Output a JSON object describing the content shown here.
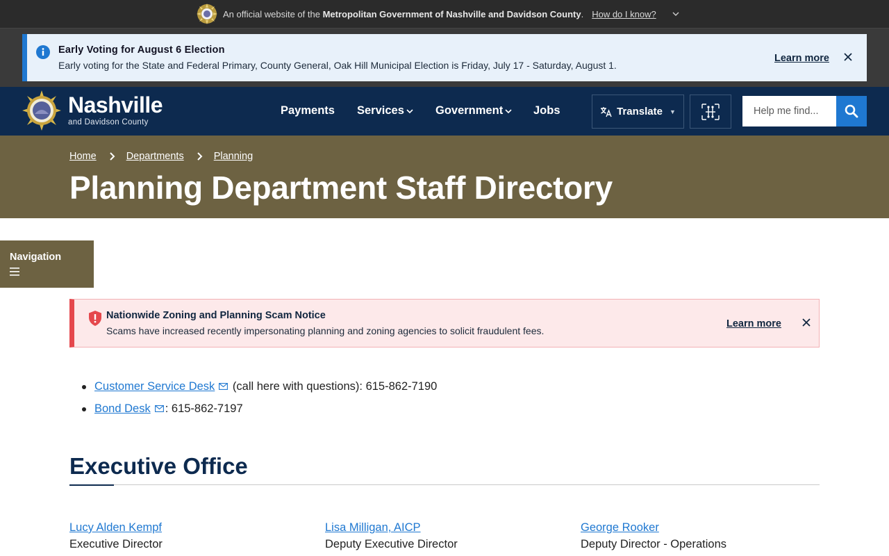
{
  "official_banner": {
    "prefix": "An official website of the",
    "org": "Metropolitan Government of Nashville and Davidson County",
    "suffix": ".",
    "how_link": "How do I know?",
    "icons": {
      "seal": "metro-seal-icon",
      "toggle": "chevron-down-icon"
    }
  },
  "alert": {
    "title": "Early Voting for August 6 Election",
    "body": "Early voting for the State and Federal Primary, County General, Oak Hill Municipal Election is Friday, July 17 - Saturday, August 1.",
    "learn_more": "Learn more",
    "icons": {
      "info": "info-icon",
      "close": "close-icon"
    },
    "accent_color": "#1f78d1"
  },
  "header": {
    "logo_title": "Nashville",
    "logo_subtitle": "and Davidson County",
    "nav": [
      {
        "label": "Payments",
        "has_dropdown": false
      },
      {
        "label": "Services",
        "has_dropdown": true
      },
      {
        "label": "Government",
        "has_dropdown": true
      },
      {
        "label": "Jobs",
        "has_dropdown": false
      }
    ],
    "translate_label": "Translate",
    "search_placeholder": "Help me find...",
    "icons": {
      "translate": "translate-icon",
      "accessibility": "accessibility-tools-icon",
      "search": "search-icon"
    },
    "background_color": "#0d2a4f"
  },
  "hero": {
    "breadcrumb": [
      "Home",
      "Departments",
      "Planning"
    ],
    "title": "Planning Department Staff Directory",
    "background_color": "#6d6242"
  },
  "side_nav": {
    "label": "Navigation",
    "icon": "menu-icon"
  },
  "scam_notice": {
    "title": "Nationwide Zoning and Planning Scam Notice",
    "body": "Scams have increased recently impersonating planning and zoning agencies to solicit fraudulent fees.",
    "learn_more": "Learn more",
    "icons": {
      "warning": "shield-alert-icon",
      "close": "close-icon"
    },
    "accent_color": "#e5484d"
  },
  "contacts": [
    {
      "link": "Customer Service Desk",
      "text": " (call here with questions): 615-862-7190",
      "icon": "mail-icon"
    },
    {
      "link": "Bond Desk",
      "text": ": 615-862-7197",
      "icon": "mail-icon"
    }
  ],
  "section": {
    "title": "Executive Office",
    "staff": [
      {
        "name": "Lucy Alden Kempf",
        "role": "Executive Director"
      },
      {
        "name": "Lisa Milligan, AICP",
        "role": "Deputy Executive Director"
      },
      {
        "name": "George Rooker",
        "role": "Deputy Director - Operations"
      }
    ]
  }
}
